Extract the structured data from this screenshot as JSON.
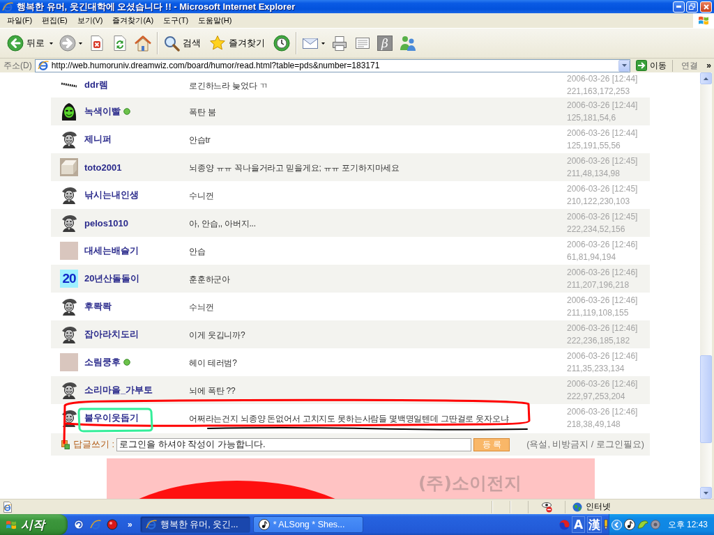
{
  "window": {
    "title": "행복한 유머, 웃긴대학에 오셨습니다 !! - Microsoft Internet Explorer"
  },
  "menu": [
    "파일(F)",
    "편집(E)",
    "보기(V)",
    "즐겨찾기(A)",
    "도구(T)",
    "도움말(H)"
  ],
  "toolbar": [
    {
      "buttons": [
        {
          "kind": "back",
          "label": "뒤로",
          "dropdown": true,
          "disabled": false
        },
        {
          "kind": "forward",
          "dropdown": true,
          "disabled": true
        },
        {
          "kind": "stop",
          "dropdown": false,
          "disabled": false
        },
        {
          "kind": "refresh",
          "dropdown": false,
          "disabled": false
        },
        {
          "kind": "home",
          "dropdown": false,
          "disabled": false
        }
      ]
    },
    {
      "buttons": [
        {
          "kind": "search",
          "label": "검색",
          "dropdown": false,
          "disabled": false
        },
        {
          "kind": "favorites",
          "label": "즐겨찾기",
          "dropdown": false,
          "disabled": false
        },
        {
          "kind": "history",
          "dropdown": false,
          "disabled": false
        }
      ]
    },
    {
      "buttons": [
        {
          "kind": "mail",
          "dropdown": true,
          "disabled": false
        },
        {
          "kind": "print",
          "dropdown": false,
          "disabled": false
        },
        {
          "kind": "edit",
          "dropdown": false,
          "disabled": false
        },
        {
          "kind": "beta",
          "glyph": "β",
          "dropdown": false,
          "disabled": false
        },
        {
          "kind": "messenger",
          "dropdown": false,
          "disabled": false
        }
      ]
    }
  ],
  "address_bar": {
    "label": "주소(D)",
    "url": "http://web.humoruniv.dreamwiz.com/board/humor/read.html?table=pds&number=183171",
    "go": "이동",
    "links": "연결",
    "chevron": "»"
  },
  "comments": [
    {
      "nickname": "ddr렘",
      "online": false,
      "avatar": {
        "kind": "dots"
      },
      "text": "로긴하느라 늦었다 ㄲ",
      "date": "2006-03-26 [12:44]",
      "ip": "221,163,172,253"
    },
    {
      "nickname": "녹색이빨",
      "online": true,
      "avatar": {
        "kind": "alien"
      },
      "text": "폭탄 붐",
      "date": "2006-03-26 [12:44]",
      "ip": "125,181,54,6"
    },
    {
      "nickname": "제니퍼",
      "online": false,
      "avatar": {
        "kind": "cap"
      },
      "text": "안습tr",
      "date": "2006-03-26 [12:44]",
      "ip": "125,191,55,56"
    },
    {
      "nickname": "toto2001",
      "online": false,
      "avatar": {
        "kind": "box"
      },
      "text": "뇌종양 ㅠㅠ 꼭나을거라고 믿을게요; ㅠㅠ 포기하지마세요",
      "date": "2006-03-26 [12:45]",
      "ip": "211,48,134,98"
    },
    {
      "nickname": "낚시는내인생",
      "online": false,
      "avatar": {
        "kind": "cap"
      },
      "text": "수니껀",
      "date": "2006-03-26 [12:45]",
      "ip": "210,122,230,103"
    },
    {
      "nickname": "pelos1010",
      "online": false,
      "avatar": {
        "kind": "cap"
      },
      "text": "아, 안습,, 아버지...",
      "date": "2006-03-26 [12:45]",
      "ip": "222,234,52,156"
    },
    {
      "nickname": "대세는배슬기",
      "online": false,
      "avatar": {
        "kind": "photo"
      },
      "text": "안습",
      "date": "2006-03-26 [12:46]",
      "ip": "61,81,94,194"
    },
    {
      "nickname": "20년산돌돌이",
      "online": false,
      "avatar": {
        "kind": "text",
        "text": "20"
      },
      "text": "훈훈하군아",
      "date": "2006-03-26 [12:46]",
      "ip": "211,207,196,218"
    },
    {
      "nickname": "후롹롹",
      "online": false,
      "avatar": {
        "kind": "cap"
      },
      "text": "수늬껀",
      "date": "2006-03-26 [12:46]",
      "ip": "211,119,108,155"
    },
    {
      "nickname": "잡아라치도리",
      "online": false,
      "avatar": {
        "kind": "cap"
      },
      "text": "이게 웃깁니까?",
      "date": "2006-03-26 [12:46]",
      "ip": "222,236,185,182"
    },
    {
      "nickname": "소림쿵후",
      "online": true,
      "avatar": {
        "kind": "photo"
      },
      "text": "헤이 테러범?",
      "date": "2006-03-26 [12:46]",
      "ip": "211,35,233,134"
    },
    {
      "nickname": "소리마을_가부토",
      "online": false,
      "avatar": {
        "kind": "cap"
      },
      "text": "뇌에 폭탄 ??",
      "date": "2006-03-26 [12:46]",
      "ip": "222,97,253,204"
    },
    {
      "nickname": "불우이웃돕기",
      "online": false,
      "avatar": {
        "kind": "cap"
      },
      "text": "어쩌라는건지 뇌종양 돈없어서 고치지도 못하는사람들 몇백명일텐데 그딴걸로 웃자오냐",
      "date": "2006-03-26 [12:46]",
      "ip": "218,38,49,148"
    }
  ],
  "reply": {
    "label": "답글쓰기 :",
    "value": "로그인을 하셔야 작성이 가능합니다.",
    "button": "등 록",
    "note": "(욕설, 비방금지 / 로그인필요)"
  },
  "banner": {
    "caption": "(주)소이전지"
  },
  "annotations": [
    {
      "kind": "outline",
      "color": "#ff0000"
    },
    {
      "kind": "box",
      "color": "#33ee99"
    },
    {
      "kind": "underline",
      "color": "#000000"
    }
  ],
  "status_bar": {
    "zone": "인터넷"
  },
  "taskbar": {
    "start": "시작",
    "chevron": "»",
    "tasks": [
      {
        "kind": "browser",
        "label": "행복한 유머, 웃긴...",
        "selected": true
      },
      {
        "kind": "music",
        "label": "* ALSong * Shes...",
        "selected": false
      }
    ],
    "input_modes": [
      "A",
      "漢"
    ],
    "clock": "오후 12:43"
  }
}
